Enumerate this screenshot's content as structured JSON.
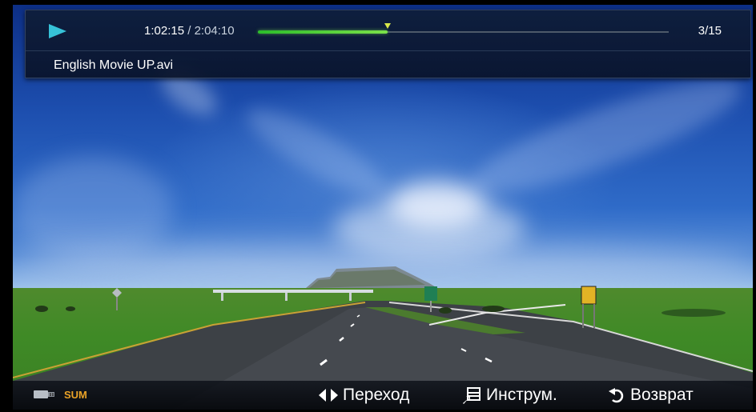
{
  "player": {
    "current_time": "1:02:15",
    "separator": " / ",
    "total_time": "2:04:10",
    "progress": 0.315,
    "counter": "3/15",
    "filename": "English Movie UP.avi",
    "state_icon": "play-icon",
    "accent_color": "#36c2d8",
    "progress_color": "#5fd63a"
  },
  "footer": {
    "device_label": "SUM",
    "device_icon": "usb-icon",
    "device_color": "#e9a227",
    "hints": {
      "move_label": "Переход",
      "move_icon": "left-right-arrows-icon",
      "tools_label": "Инструм.",
      "tools_icon": "tools-icon",
      "return_label": "Возврат",
      "return_icon": "return-icon"
    }
  }
}
